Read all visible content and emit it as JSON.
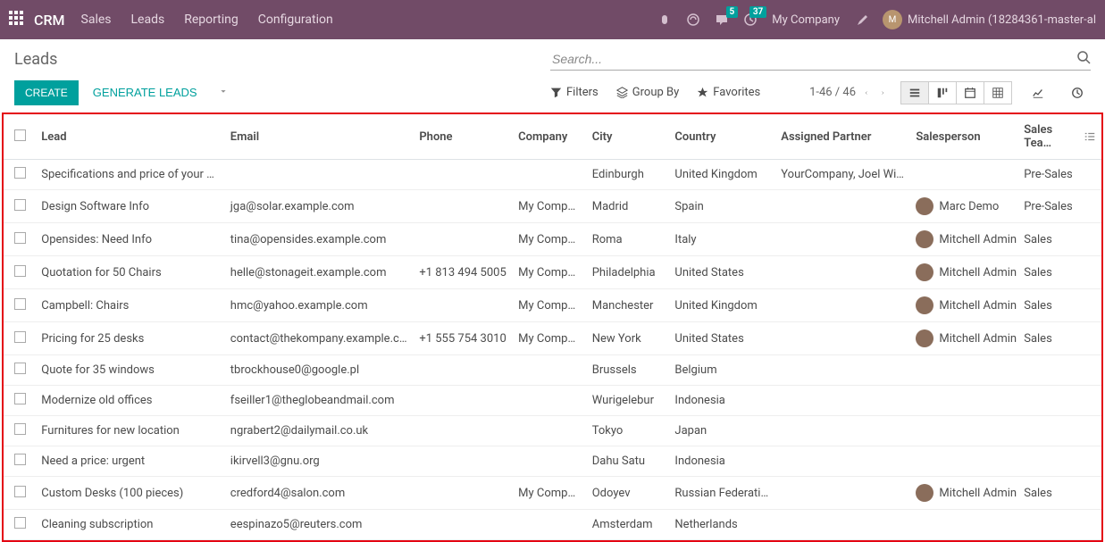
{
  "topbar": {
    "brand": "CRM",
    "nav": [
      "Sales",
      "Leads",
      "Reporting",
      "Configuration"
    ],
    "msg_badge": "5",
    "activity_badge": "37",
    "company": "My Company",
    "user": "Mitchell Admin (18284361-master-al"
  },
  "control": {
    "title": "Leads",
    "search_placeholder": "Search...",
    "create": "CREATE",
    "generate": "GENERATE LEADS",
    "filters": "Filters",
    "groupby": "Group By",
    "favorites": "Favorites",
    "pager": "1-46 / 46"
  },
  "columns": {
    "lead": "Lead",
    "email": "Email",
    "phone": "Phone",
    "company": "Company",
    "city": "City",
    "country": "Country",
    "partner": "Assigned Partner",
    "salesperson": "Salesperson",
    "team": "Sales Tea…"
  },
  "rows": [
    {
      "lead": "Specifications and price of your ph…",
      "email": "",
      "phone": "",
      "company": "",
      "city": "Edinburgh",
      "country": "United Kingdom",
      "partner": "YourCompany, Joel Will…",
      "sp": "",
      "team": "Pre-Sales"
    },
    {
      "lead": "Design Software Info",
      "email": "jga@solar.example.com",
      "phone": "",
      "company": "My Company",
      "city": "Madrid",
      "country": "Spain",
      "partner": "",
      "sp": "Marc Demo",
      "team": "Pre-Sales"
    },
    {
      "lead": "Opensides: Need Info",
      "email": "tina@opensides.example.com",
      "phone": "",
      "company": "My Company",
      "city": "Roma",
      "country": "Italy",
      "partner": "",
      "sp": "Mitchell Admin",
      "team": "Sales"
    },
    {
      "lead": "Quotation for 50 Chairs",
      "email": "helle@stonageit.example.com",
      "phone": "+1 813 494 5005",
      "company": "My Company",
      "city": "Philadelphia",
      "country": "United States",
      "partner": "",
      "sp": "Mitchell Admin",
      "team": "Sales"
    },
    {
      "lead": "Campbell: Chairs",
      "email": "hmc@yahoo.example.com",
      "phone": "",
      "company": "My Company",
      "city": "Manchester",
      "country": "United Kingdom",
      "partner": "",
      "sp": "Mitchell Admin",
      "team": "Sales"
    },
    {
      "lead": "Pricing for 25 desks",
      "email": "contact@thekompany.example.co…",
      "phone": "+1 555 754 3010",
      "company": "My Company",
      "city": "New York",
      "country": "United States",
      "partner": "",
      "sp": "Mitchell Admin",
      "team": "Sales"
    },
    {
      "lead": "Quote for 35 windows",
      "email": "tbrockhouse0@google.pl",
      "phone": "",
      "company": "",
      "city": "Brussels",
      "country": "Belgium",
      "partner": "",
      "sp": "",
      "team": ""
    },
    {
      "lead": "Modernize old offices",
      "email": "fseiller1@theglobeandmail.com",
      "phone": "",
      "company": "",
      "city": "Wurigelebur",
      "country": "Indonesia",
      "partner": "",
      "sp": "",
      "team": ""
    },
    {
      "lead": "Furnitures for new location",
      "email": "ngrabert2@dailymail.co.uk",
      "phone": "",
      "company": "",
      "city": "Tokyo",
      "country": "Japan",
      "partner": "",
      "sp": "",
      "team": ""
    },
    {
      "lead": "Need a price: urgent",
      "email": "ikirvell3@gnu.org",
      "phone": "",
      "company": "",
      "city": "Dahu Satu",
      "country": "Indonesia",
      "partner": "",
      "sp": "",
      "team": ""
    },
    {
      "lead": "Custom Desks (100 pieces)",
      "email": "credford4@salon.com",
      "phone": "",
      "company": "My Company",
      "city": "Odoyev",
      "country": "Russian Federation",
      "partner": "",
      "sp": "Mitchell Admin",
      "team": "Sales"
    },
    {
      "lead": "Cleaning subscription",
      "email": "eespinazo5@reuters.com",
      "phone": "",
      "company": "",
      "city": "Amsterdam",
      "country": "Netherlands",
      "partner": "",
      "sp": "",
      "team": ""
    }
  ]
}
